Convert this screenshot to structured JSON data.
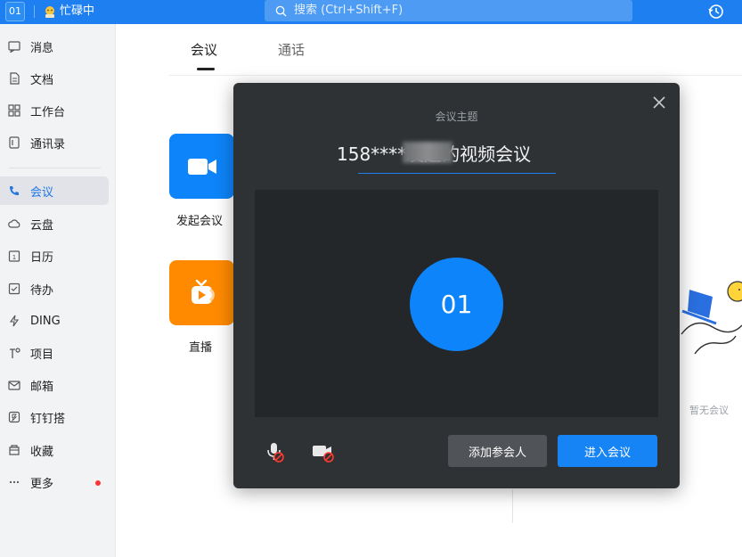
{
  "topbar": {
    "user_badge": "01",
    "status_text": "忙碌中",
    "search_placeholder": "搜索 (Ctrl+Shift+F)"
  },
  "sidebar": {
    "items": [
      {
        "label": "消息",
        "icon": "message-icon"
      },
      {
        "label": "文档",
        "icon": "document-icon"
      },
      {
        "label": "工作台",
        "icon": "workbench-icon"
      },
      {
        "label": "通讯录",
        "icon": "contacts-icon"
      },
      {
        "label": "会议",
        "icon": "phone-icon",
        "active": true
      },
      {
        "label": "云盘",
        "icon": "cloud-icon"
      },
      {
        "label": "日历",
        "icon": "calendar-icon"
      },
      {
        "label": "待办",
        "icon": "todo-icon"
      },
      {
        "label": "DING",
        "icon": "lightning-icon"
      },
      {
        "label": "项目",
        "icon": "project-icon"
      },
      {
        "label": "邮箱",
        "icon": "mail-icon"
      },
      {
        "label": "钉钉搭",
        "icon": "builder-icon"
      },
      {
        "label": "收藏",
        "icon": "favorite-icon"
      },
      {
        "label": "更多",
        "icon": "more-icon",
        "notification_dot": true
      }
    ]
  },
  "main": {
    "tabs": [
      {
        "label": "会议",
        "active": true
      },
      {
        "label": "通话",
        "active": false
      }
    ],
    "actions": [
      {
        "label": "发起会议",
        "icon": "video-camera-icon",
        "color": "#0d84f9"
      },
      {
        "label": "直播",
        "icon": "live-tv-icon",
        "color": "#ff8a00"
      }
    ],
    "empty_text": "暂无会议"
  },
  "modal": {
    "label": "会议主题",
    "title": "158****发起的视频会议",
    "avatar_text": "01",
    "add_button": "添加参会人",
    "join_button": "进入会议"
  },
  "colors": {
    "brand": "#1e7ff0",
    "modal_bg": "#2f3235",
    "primary_button": "#1784f5",
    "live_orange": "#ff8a00"
  }
}
